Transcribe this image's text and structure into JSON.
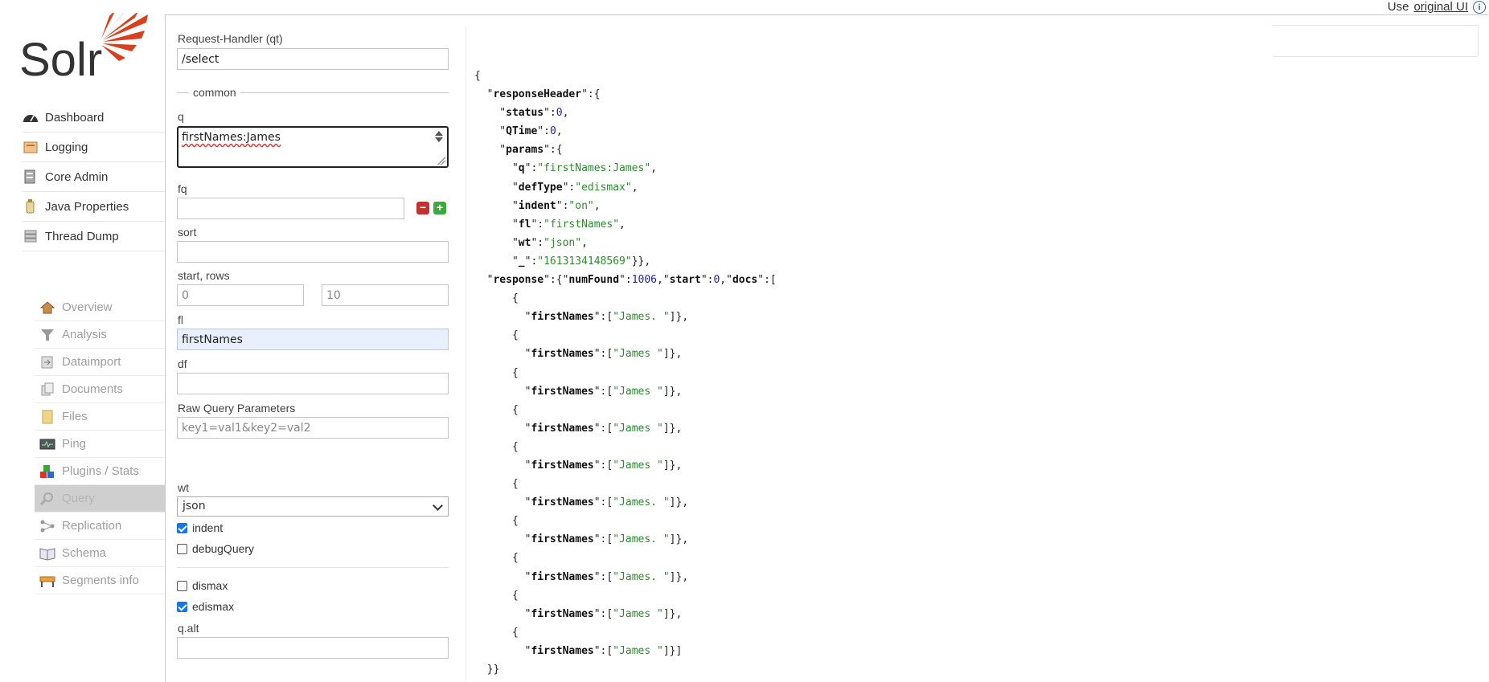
{
  "topbar": {
    "prefix": "Use",
    "link": "original UI",
    "info": "i"
  },
  "logo": {
    "text": "Solr"
  },
  "nav": [
    {
      "label": "Dashboard",
      "icon": "dashboard-icon"
    },
    {
      "label": "Logging",
      "icon": "logging-icon"
    },
    {
      "label": "Core Admin",
      "icon": "core-admin-icon"
    },
    {
      "label": "Java Properties",
      "icon": "java-icon"
    },
    {
      "label": "Thread Dump",
      "icon": "thread-dump-icon"
    }
  ],
  "core_nav": [
    {
      "label": "Overview",
      "icon": "home-icon"
    },
    {
      "label": "Analysis",
      "icon": "funnel-icon"
    },
    {
      "label": "Dataimport",
      "icon": "dataimport-icon"
    },
    {
      "label": "Documents",
      "icon": "documents-icon"
    },
    {
      "label": "Files",
      "icon": "files-icon"
    },
    {
      "label": "Ping",
      "icon": "ping-icon"
    },
    {
      "label": "Plugins / Stats",
      "icon": "plugins-icon"
    },
    {
      "label": "Query",
      "icon": "magnifier-icon"
    },
    {
      "label": "Replication",
      "icon": "replication-icon"
    },
    {
      "label": "Schema",
      "icon": "schema-icon"
    },
    {
      "label": "Segments info",
      "icon": "segments-icon"
    }
  ],
  "form": {
    "handler_label": "Request-Handler (qt)",
    "handler_value": "/select",
    "common_legend": "common",
    "q_label": "q",
    "q_value": "firstNames:James",
    "fq_label": "fq",
    "fq_value": "",
    "sort_label": "sort",
    "sort_value": "",
    "startrows_label": "start, rows",
    "start_placeholder": "0",
    "rows_placeholder": "10",
    "fl_label": "fl",
    "fl_value": "firstNames",
    "df_label": "df",
    "df_value": "",
    "raw_label": "Raw Query Parameters",
    "raw_placeholder": "key1=val1&key2=val2",
    "wt_label": "wt",
    "wt_value": "json",
    "indent_label": "indent",
    "indent_checked": true,
    "debug_label": "debugQuery",
    "debug_checked": false,
    "dismax_label": "dismax",
    "dismax_checked": false,
    "edismax_label": "edismax",
    "edismax_checked": true,
    "qalt_label": "q.alt",
    "qalt_value": ""
  },
  "response": {
    "params": {
      "q": "firstNames:James",
      "defType": "edismax",
      "indent": "on",
      "fl": "firstNames",
      "wt": "json",
      "_": "1613134148569"
    },
    "status": "0",
    "QTime": "0",
    "numFound": "1006",
    "start": "0",
    "docs": [
      "James. ",
      "James ",
      "James ",
      "James ",
      "James ",
      "James. ",
      "James. ",
      "James. ",
      "James ",
      "James "
    ]
  }
}
